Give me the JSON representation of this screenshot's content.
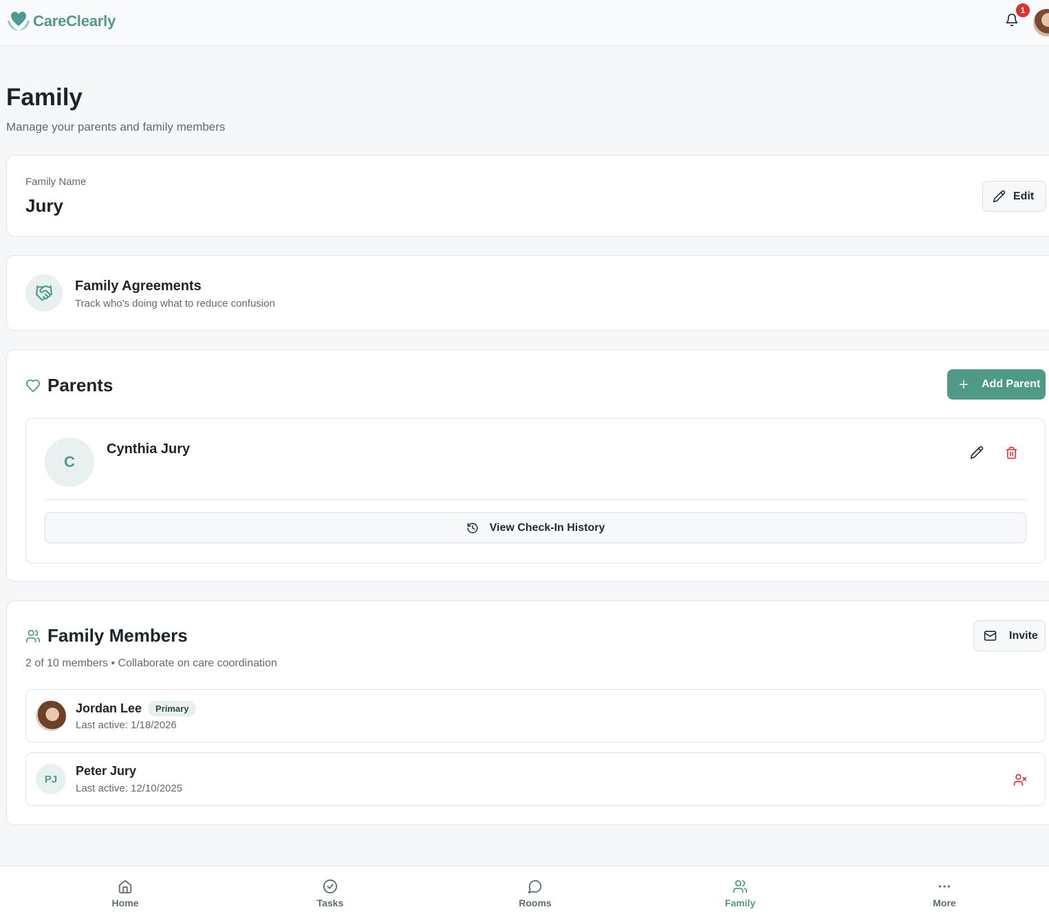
{
  "app": {
    "name": "CareClearly"
  },
  "header": {
    "notification_count": "1"
  },
  "page": {
    "title": "Family",
    "subtitle": "Manage your parents and family members"
  },
  "family_card": {
    "label": "Family Name",
    "name": "Jury",
    "edit_label": "Edit"
  },
  "agreements": {
    "title": "Family Agreements",
    "subtitle": "Track who's doing what to reduce confusion"
  },
  "parents": {
    "title": "Parents",
    "add_label": "Add Parent",
    "items": [
      {
        "initial": "C",
        "name": "Cynthia Jury",
        "history_label": "View Check-In History"
      }
    ]
  },
  "members": {
    "title": "Family Members",
    "subtitle": "2 of 10 members • Collaborate on care coordination",
    "invite_label": "Invite",
    "items": [
      {
        "name": "Jordan Lee",
        "badge": "Primary",
        "last_active": "Last active: 1/18/2026",
        "initials": ""
      },
      {
        "name": "Peter Jury",
        "badge": "",
        "last_active": "Last active: 12/10/2025",
        "initials": "PJ"
      }
    ]
  },
  "nav": {
    "items": [
      {
        "label": "Home",
        "icon": "home-icon"
      },
      {
        "label": "Tasks",
        "icon": "check-circle-icon"
      },
      {
        "label": "Rooms",
        "icon": "chat-bubble-icon"
      },
      {
        "label": "Family",
        "icon": "users-icon",
        "active": true
      },
      {
        "label": "More",
        "icon": "more-dots-icon"
      }
    ]
  },
  "colors": {
    "brand": "#4f9a86",
    "danger": "#dc2f2f",
    "background": "#f6f7f8"
  }
}
